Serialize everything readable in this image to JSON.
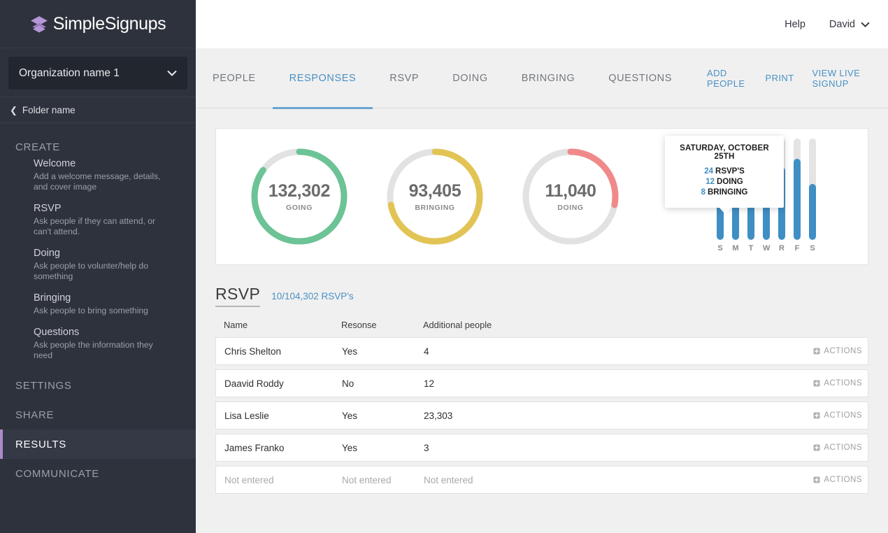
{
  "brand": {
    "name": "SimpleSignups",
    "logo_icon": "layers-icon",
    "accent": "#a98cc8"
  },
  "sidebar": {
    "org_select": {
      "value": "Organization name 1",
      "icon": "chevron-down-icon"
    },
    "folder": {
      "label": "Folder name",
      "icon": "chevron-left-icon"
    },
    "create_label": "CREATE",
    "create_items": [
      {
        "title": "Welcome",
        "desc": "Add a welcome message, details, and cover image"
      },
      {
        "title": "RSVP",
        "desc": "Ask people if they can attend, or can't attend."
      },
      {
        "title": "Doing",
        "desc": "Ask people to volunter/help do something"
      },
      {
        "title": "Bringing",
        "desc": "Ask people to bring something"
      },
      {
        "title": "Questions",
        "desc": "Ask people the information they need"
      }
    ],
    "nav": [
      {
        "label": "SETTINGS",
        "active": false
      },
      {
        "label": "SHARE",
        "active": false
      },
      {
        "label": "RESULTS",
        "active": true
      },
      {
        "label": "COMMUNICATE",
        "active": false
      }
    ]
  },
  "topbar": {
    "help": "Help",
    "user": "David",
    "user_icon": "chevron-down-icon"
  },
  "tabs": [
    {
      "label": "PEOPLE",
      "active": false
    },
    {
      "label": "RESPONSES",
      "active": true
    },
    {
      "label": "RSVP",
      "active": false
    },
    {
      "label": "DOING",
      "active": false
    },
    {
      "label": "BRINGING",
      "active": false
    },
    {
      "label": "QUESTIONS",
      "active": false
    }
  ],
  "tab_actions": [
    {
      "label": "ADD PEOPLE"
    },
    {
      "label": "PRINT"
    },
    {
      "label": "VIEW LIVE SIGNUP"
    }
  ],
  "chart_data": [
    {
      "type": "pie",
      "title": "GOING",
      "values": [
        132302
      ],
      "value_label": "132,302",
      "percent": 85,
      "color": "#6cc395",
      "track_color": "#e2e2e2"
    },
    {
      "type": "pie",
      "title": "BRINGING",
      "values": [
        93405
      ],
      "value_label": "93,405",
      "percent": 72,
      "color": "#e2c455",
      "track_color": "#e2e2e2"
    },
    {
      "type": "pie",
      "title": "DOING",
      "values": [
        11040
      ],
      "value_label": "11,040",
      "percent": 28,
      "color": "#f08a8a",
      "track_color": "#e2e2e2"
    },
    {
      "type": "bar",
      "categories": [
        "S",
        "M",
        "T",
        "W",
        "R",
        "F",
        "S"
      ],
      "values": [
        62,
        66,
        46,
        43,
        72,
        80,
        55
      ],
      "title": "",
      "xlabel": "",
      "ylabel": "",
      "ylim": [
        0,
        100
      ],
      "color": "#3f8ec4",
      "track_color": "#e4e4e4",
      "grid": false,
      "tooltip": {
        "title": "SATURDAY, OCTOBER 25TH",
        "rows": [
          {
            "num": "24",
            "label": "RSVP'S"
          },
          {
            "num": "12",
            "label": "DOING"
          },
          {
            "num": "8",
            "label": "BRINGING"
          }
        ]
      }
    }
  ],
  "rsvp": {
    "title": "RSVP",
    "count": "10/104,302 RSVP's",
    "columns": [
      "Name",
      "Resonse",
      "Additional people"
    ],
    "actions_label": "ACTIONS",
    "actions_icon": "plus-square-icon",
    "rows": [
      {
        "name": "Chris Shelton",
        "response": "Yes",
        "additional": "4",
        "muted": false
      },
      {
        "name": "Daavid Roddy",
        "response": "No",
        "additional": "12",
        "muted": false
      },
      {
        "name": "Lisa Leslie",
        "response": "Yes",
        "additional": "23,303",
        "muted": false
      },
      {
        "name": "James Franko",
        "response": "Yes",
        "additional": "3",
        "muted": false
      },
      {
        "name": "Not entered",
        "response": "Not entered",
        "additional": "Not entered",
        "muted": true
      }
    ]
  }
}
